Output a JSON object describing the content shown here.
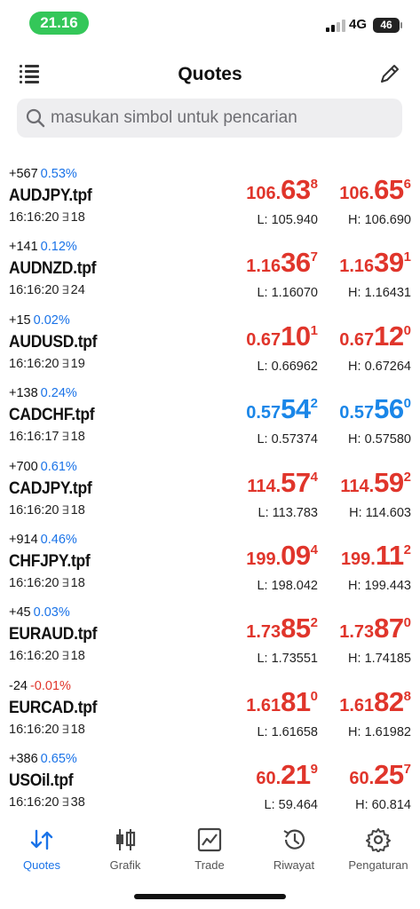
{
  "status": {
    "time": "21.16",
    "network": "4G",
    "battery": "46"
  },
  "header": {
    "title": "Quotes"
  },
  "search": {
    "placeholder": "masukan simbol untuk pencarian"
  },
  "colors": {
    "up": "#1a86e8",
    "down": "#e0352b",
    "accent": "#1a73e8",
    "time_pill": "#34c759"
  },
  "quotes": [
    {
      "change": "+567",
      "pct": "0.53%",
      "pct_negative": false,
      "symbol": "AUDJPY.tpf",
      "time": "16:16:20",
      "spread": "18",
      "bid": {
        "small": "106.",
        "big": "63",
        "sup": "8",
        "color": "red"
      },
      "ask": {
        "small": "106.",
        "big": "65",
        "sup": "6",
        "color": "red"
      },
      "low": "L: 105.940",
      "high": "H: 106.690"
    },
    {
      "change": "+141",
      "pct": "0.12%",
      "pct_negative": false,
      "symbol": "AUDNZD.tpf",
      "time": "16:16:20",
      "spread": "24",
      "bid": {
        "small": "1.16",
        "big": "36",
        "sup": "7",
        "color": "red"
      },
      "ask": {
        "small": "1.16",
        "big": "39",
        "sup": "1",
        "color": "red"
      },
      "low": "L: 1.16070",
      "high": "H: 1.16431"
    },
    {
      "change": "+15",
      "pct": "0.02%",
      "pct_negative": false,
      "symbol": "AUDUSD.tpf",
      "time": "16:16:20",
      "spread": "19",
      "bid": {
        "small": "0.67",
        "big": "10",
        "sup": "1",
        "color": "red"
      },
      "ask": {
        "small": "0.67",
        "big": "12",
        "sup": "0",
        "color": "red"
      },
      "low": "L: 0.66962",
      "high": "H: 0.67264"
    },
    {
      "change": "+138",
      "pct": "0.24%",
      "pct_negative": false,
      "symbol": "CADCHF.tpf",
      "time": "16:16:17",
      "spread": "18",
      "bid": {
        "small": "0.57",
        "big": "54",
        "sup": "2",
        "color": "blue"
      },
      "ask": {
        "small": "0.57",
        "big": "56",
        "sup": "0",
        "color": "blue"
      },
      "low": "L: 0.57374",
      "high": "H: 0.57580"
    },
    {
      "change": "+700",
      "pct": "0.61%",
      "pct_negative": false,
      "symbol": "CADJPY.tpf",
      "time": "16:16:20",
      "spread": "18",
      "bid": {
        "small": "114.",
        "big": "57",
        "sup": "4",
        "color": "red"
      },
      "ask": {
        "small": "114.",
        "big": "59",
        "sup": "2",
        "color": "red"
      },
      "low": "L: 113.783",
      "high": "H: 114.603"
    },
    {
      "change": "+914",
      "pct": "0.46%",
      "pct_negative": false,
      "symbol": "CHFJPY.tpf",
      "time": "16:16:20",
      "spread": "18",
      "bid": {
        "small": "199.",
        "big": "09",
        "sup": "4",
        "color": "red"
      },
      "ask": {
        "small": "199.",
        "big": "11",
        "sup": "2",
        "color": "red"
      },
      "low": "L: 198.042",
      "high": "H: 199.443"
    },
    {
      "change": "+45",
      "pct": "0.03%",
      "pct_negative": false,
      "symbol": "EURAUD.tpf",
      "time": "16:16:20",
      "spread": "18",
      "bid": {
        "small": "1.73",
        "big": "85",
        "sup": "2",
        "color": "red"
      },
      "ask": {
        "small": "1.73",
        "big": "87",
        "sup": "0",
        "color": "red"
      },
      "low": "L: 1.73551",
      "high": "H: 1.74185"
    },
    {
      "change": "-24",
      "pct": "-0.01%",
      "pct_negative": true,
      "symbol": "EURCAD.tpf",
      "time": "16:16:20",
      "spread": "18",
      "bid": {
        "small": "1.61",
        "big": "81",
        "sup": "0",
        "color": "red"
      },
      "ask": {
        "small": "1.61",
        "big": "82",
        "sup": "8",
        "color": "red"
      },
      "low": "L: 1.61658",
      "high": "H: 1.61982"
    },
    {
      "change": "+386",
      "pct": "0.65%",
      "pct_negative": false,
      "symbol": "USOil.tpf",
      "time": "16:16:20",
      "spread": "38",
      "bid": {
        "small": "60.",
        "big": "21",
        "sup": "9",
        "color": "red"
      },
      "ask": {
        "small": "60.",
        "big": "25",
        "sup": "7",
        "color": "red"
      },
      "low": "L: 59.464",
      "high": "H: 60.814"
    }
  ],
  "nav": [
    {
      "label": "Quotes",
      "icon": "quotes-icon",
      "active": true
    },
    {
      "label": "Grafik",
      "icon": "chart-candles-icon",
      "active": false
    },
    {
      "label": "Trade",
      "icon": "trade-icon",
      "active": false
    },
    {
      "label": "Riwayat",
      "icon": "history-icon",
      "active": false
    },
    {
      "label": "Pengaturan",
      "icon": "gear-icon",
      "active": false
    }
  ]
}
